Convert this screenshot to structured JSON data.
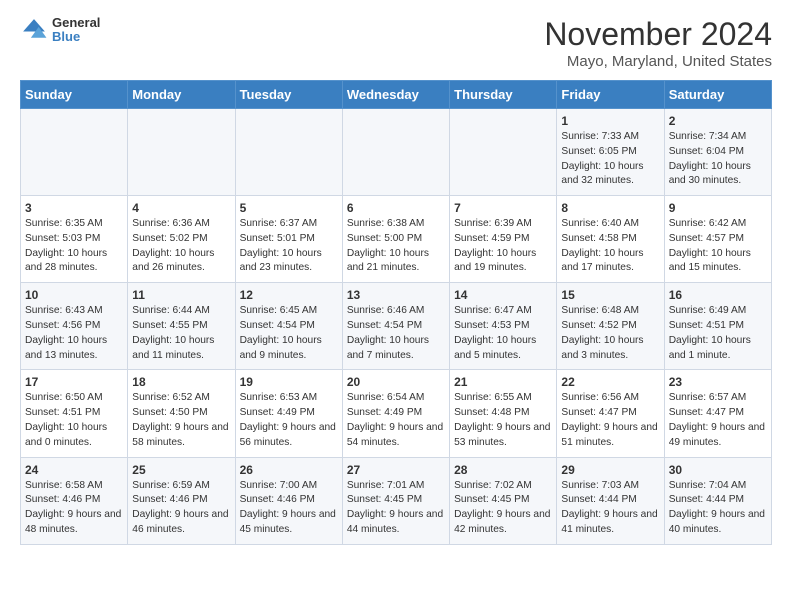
{
  "logo": {
    "general": "General",
    "blue": "Blue"
  },
  "title": "November 2024",
  "subtitle": "Mayo, Maryland, United States",
  "weekdays": [
    "Sunday",
    "Monday",
    "Tuesday",
    "Wednesday",
    "Thursday",
    "Friday",
    "Saturday"
  ],
  "weeks": [
    [
      {
        "day": "",
        "info": ""
      },
      {
        "day": "",
        "info": ""
      },
      {
        "day": "",
        "info": ""
      },
      {
        "day": "",
        "info": ""
      },
      {
        "day": "",
        "info": ""
      },
      {
        "day": "1",
        "info": "Sunrise: 7:33 AM\nSunset: 6:05 PM\nDaylight: 10 hours and 32 minutes."
      },
      {
        "day": "2",
        "info": "Sunrise: 7:34 AM\nSunset: 6:04 PM\nDaylight: 10 hours and 30 minutes."
      }
    ],
    [
      {
        "day": "3",
        "info": "Sunrise: 6:35 AM\nSunset: 5:03 PM\nDaylight: 10 hours and 28 minutes."
      },
      {
        "day": "4",
        "info": "Sunrise: 6:36 AM\nSunset: 5:02 PM\nDaylight: 10 hours and 26 minutes."
      },
      {
        "day": "5",
        "info": "Sunrise: 6:37 AM\nSunset: 5:01 PM\nDaylight: 10 hours and 23 minutes."
      },
      {
        "day": "6",
        "info": "Sunrise: 6:38 AM\nSunset: 5:00 PM\nDaylight: 10 hours and 21 minutes."
      },
      {
        "day": "7",
        "info": "Sunrise: 6:39 AM\nSunset: 4:59 PM\nDaylight: 10 hours and 19 minutes."
      },
      {
        "day": "8",
        "info": "Sunrise: 6:40 AM\nSunset: 4:58 PM\nDaylight: 10 hours and 17 minutes."
      },
      {
        "day": "9",
        "info": "Sunrise: 6:42 AM\nSunset: 4:57 PM\nDaylight: 10 hours and 15 minutes."
      }
    ],
    [
      {
        "day": "10",
        "info": "Sunrise: 6:43 AM\nSunset: 4:56 PM\nDaylight: 10 hours and 13 minutes."
      },
      {
        "day": "11",
        "info": "Sunrise: 6:44 AM\nSunset: 4:55 PM\nDaylight: 10 hours and 11 minutes."
      },
      {
        "day": "12",
        "info": "Sunrise: 6:45 AM\nSunset: 4:54 PM\nDaylight: 10 hours and 9 minutes."
      },
      {
        "day": "13",
        "info": "Sunrise: 6:46 AM\nSunset: 4:54 PM\nDaylight: 10 hours and 7 minutes."
      },
      {
        "day": "14",
        "info": "Sunrise: 6:47 AM\nSunset: 4:53 PM\nDaylight: 10 hours and 5 minutes."
      },
      {
        "day": "15",
        "info": "Sunrise: 6:48 AM\nSunset: 4:52 PM\nDaylight: 10 hours and 3 minutes."
      },
      {
        "day": "16",
        "info": "Sunrise: 6:49 AM\nSunset: 4:51 PM\nDaylight: 10 hours and 1 minute."
      }
    ],
    [
      {
        "day": "17",
        "info": "Sunrise: 6:50 AM\nSunset: 4:51 PM\nDaylight: 10 hours and 0 minutes."
      },
      {
        "day": "18",
        "info": "Sunrise: 6:52 AM\nSunset: 4:50 PM\nDaylight: 9 hours and 58 minutes."
      },
      {
        "day": "19",
        "info": "Sunrise: 6:53 AM\nSunset: 4:49 PM\nDaylight: 9 hours and 56 minutes."
      },
      {
        "day": "20",
        "info": "Sunrise: 6:54 AM\nSunset: 4:49 PM\nDaylight: 9 hours and 54 minutes."
      },
      {
        "day": "21",
        "info": "Sunrise: 6:55 AM\nSunset: 4:48 PM\nDaylight: 9 hours and 53 minutes."
      },
      {
        "day": "22",
        "info": "Sunrise: 6:56 AM\nSunset: 4:47 PM\nDaylight: 9 hours and 51 minutes."
      },
      {
        "day": "23",
        "info": "Sunrise: 6:57 AM\nSunset: 4:47 PM\nDaylight: 9 hours and 49 minutes."
      }
    ],
    [
      {
        "day": "24",
        "info": "Sunrise: 6:58 AM\nSunset: 4:46 PM\nDaylight: 9 hours and 48 minutes."
      },
      {
        "day": "25",
        "info": "Sunrise: 6:59 AM\nSunset: 4:46 PM\nDaylight: 9 hours and 46 minutes."
      },
      {
        "day": "26",
        "info": "Sunrise: 7:00 AM\nSunset: 4:46 PM\nDaylight: 9 hours and 45 minutes."
      },
      {
        "day": "27",
        "info": "Sunrise: 7:01 AM\nSunset: 4:45 PM\nDaylight: 9 hours and 44 minutes."
      },
      {
        "day": "28",
        "info": "Sunrise: 7:02 AM\nSunset: 4:45 PM\nDaylight: 9 hours and 42 minutes."
      },
      {
        "day": "29",
        "info": "Sunrise: 7:03 AM\nSunset: 4:44 PM\nDaylight: 9 hours and 41 minutes."
      },
      {
        "day": "30",
        "info": "Sunrise: 7:04 AM\nSunset: 4:44 PM\nDaylight: 9 hours and 40 minutes."
      }
    ]
  ]
}
